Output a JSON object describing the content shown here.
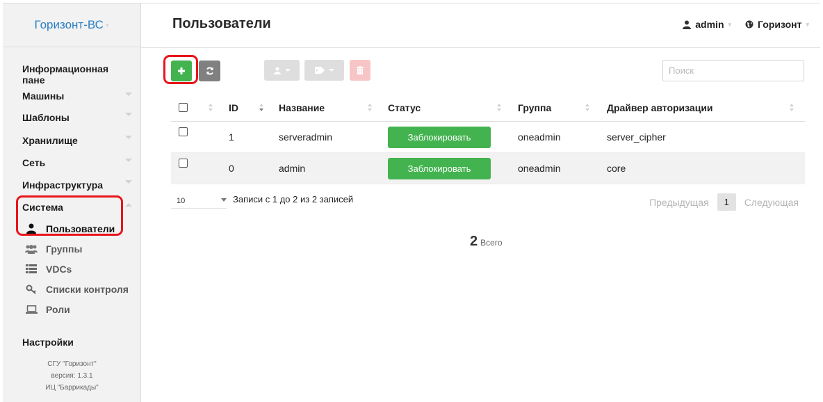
{
  "sidebar": {
    "brand": "Горизонт-ВС",
    "menu": [
      {
        "label": "Информационная пане"
      },
      {
        "label": "Машины"
      },
      {
        "label": "Шаблоны"
      },
      {
        "label": "Хранилище"
      },
      {
        "label": "Сеть"
      },
      {
        "label": "Инфраструктура"
      },
      {
        "label": "Система"
      }
    ],
    "system_items": [
      {
        "label": "Пользователи",
        "icon": "user-icon",
        "active": true
      },
      {
        "label": "Группы",
        "icon": "users-icon"
      },
      {
        "label": "VDCs",
        "icon": "list-icon"
      },
      {
        "label": "Списки контроля",
        "icon": "key-icon"
      },
      {
        "label": "Роли",
        "icon": "laptop-icon"
      }
    ],
    "settings": "Настройки",
    "footer": [
      "СГУ \"Горизонт\"",
      "версия: 1.3.1",
      "ИЦ \"Баррикады\""
    ]
  },
  "header": {
    "title": "Пользователи",
    "user": "admin",
    "zone": "Горизонт"
  },
  "toolbar": {
    "search_placeholder": "Поиск"
  },
  "table": {
    "columns": [
      "ID",
      "Название",
      "Статус",
      "Группа",
      "Драйвер авторизации"
    ],
    "rows": [
      {
        "id": "1",
        "name": "serveradmin",
        "status": "Заблокировать",
        "group": "oneadmin",
        "driver": "server_cipher"
      },
      {
        "id": "0",
        "name": "admin",
        "status": "Заблокировать",
        "group": "oneadmin",
        "driver": "core"
      }
    ]
  },
  "pagination": {
    "page_size": "10",
    "info": "Записи с 1 до 2 из 2 записей",
    "prev": "Предыдущая",
    "page": "1",
    "next": "Следующая"
  },
  "summary": {
    "count": "2",
    "label": "Всего"
  },
  "colors": {
    "accent_green": "#43b34f",
    "brand_blue": "#2b80c4",
    "highlight_red": "#e8151b"
  }
}
